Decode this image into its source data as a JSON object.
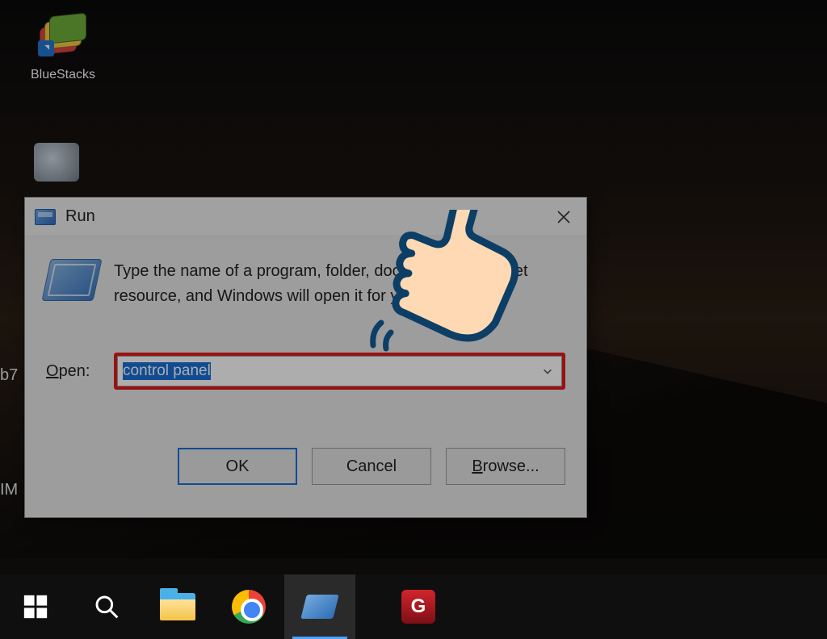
{
  "desktop": {
    "icons": {
      "bluestacks_label": "BlueStacks",
      "partial_b7": "b7",
      "partial_im": "IM"
    }
  },
  "run_dialog": {
    "title": "Run",
    "description": "Type the name of a program, folder, document, or Internet resource, and Windows will open it for you.",
    "open_label_underline": "O",
    "open_label_rest": "pen:",
    "input_value": "control panel",
    "buttons": {
      "ok": "OK",
      "cancel": "Cancel",
      "browse_underline": "B",
      "browse_rest": "rowse..."
    }
  },
  "taskbar": {
    "start": "Start",
    "search": "Search",
    "explorer": "File Explorer",
    "chrome": "Google Chrome",
    "run": "Run",
    "app": "Garena"
  }
}
